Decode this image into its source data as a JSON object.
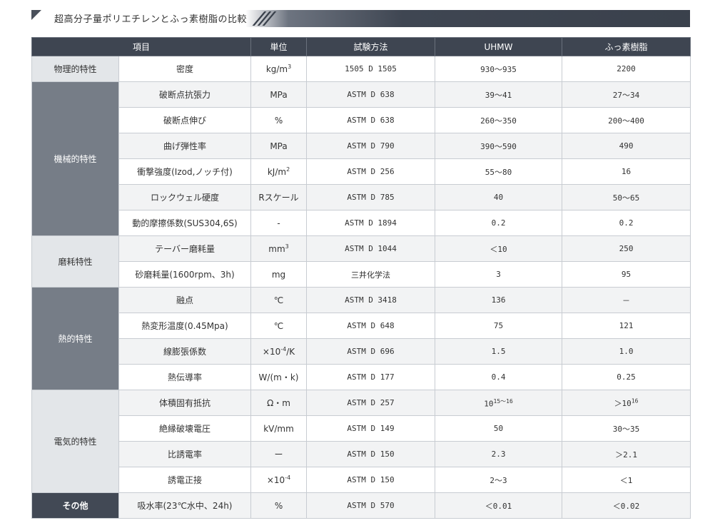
{
  "title": "超高分子量ポリエチレンとふっ素樹脂の比較",
  "headers": [
    "項目",
    "単位",
    "試験方法",
    "UHMW",
    "ふっ素樹脂"
  ],
  "rows": [
    {
      "cat": "物理的特性",
      "span": 1,
      "cls": "c0",
      "item": "密度",
      "unit": "kg/m",
      "unit_sup": "3",
      "method": "1505 D 1505",
      "uhmw": "930～935",
      "uhmw_sup": "",
      "fluoro": "2200",
      "fluoro_sup": ""
    },
    {
      "cat": "機械的特性",
      "span": 6,
      "cls": "c1",
      "item": "破断点抗張力",
      "unit": "MPa",
      "unit_sup": "",
      "method": "ASTM D 638",
      "uhmw": "39～41",
      "uhmw_sup": "",
      "fluoro": "27～34",
      "fluoro_sup": ""
    },
    {
      "item": "破断点伸び",
      "unit": "%",
      "unit_sup": "",
      "method": "ASTM D 638",
      "uhmw": "260～350",
      "uhmw_sup": "",
      "fluoro": "200～400",
      "fluoro_sup": ""
    },
    {
      "item": "曲げ弾性率",
      "unit": "MPa",
      "unit_sup": "",
      "method": "ASTM D 790",
      "uhmw": "390～590",
      "uhmw_sup": "",
      "fluoro": "490",
      "fluoro_sup": ""
    },
    {
      "item": "衝撃強度(Izod,ノッチ付)",
      "unit": "kJ/m",
      "unit_sup": "2",
      "method": "ASTM D 256",
      "uhmw": "55～80",
      "uhmw_sup": "",
      "fluoro": "16",
      "fluoro_sup": ""
    },
    {
      "item": "ロックウェル硬度",
      "unit": "Rスケール",
      "unit_sup": "",
      "method": "ASTM D 785",
      "uhmw": "40",
      "uhmw_sup": "",
      "fluoro": "50～65",
      "fluoro_sup": ""
    },
    {
      "item": "動的摩擦係数(SUS304,6S)",
      "unit": "-",
      "unit_sup": "",
      "method": "ASTM D 1894",
      "uhmw": "0.2",
      "uhmw_sup": "",
      "fluoro": "0.2",
      "fluoro_sup": ""
    },
    {
      "cat": "磨耗特性",
      "span": 2,
      "cls": "c2",
      "item": "テーバー磨耗量",
      "unit": "mm",
      "unit_sup": "3",
      "method": "ASTM D 1044",
      "uhmw": "＜10",
      "uhmw_sup": "",
      "fluoro": "250",
      "fluoro_sup": ""
    },
    {
      "item": "砂磨耗量(1600rpm、3h)",
      "unit": "mg",
      "unit_sup": "",
      "method": "三井化学法",
      "uhmw": "3",
      "uhmw_sup": "",
      "fluoro": "95",
      "fluoro_sup": ""
    },
    {
      "cat": "熱的特性",
      "span": 4,
      "cls": "c3",
      "item": "融点",
      "unit": "℃",
      "unit_sup": "",
      "method": "ASTM D 3418",
      "uhmw": "136",
      "uhmw_sup": "",
      "fluoro": "－",
      "fluoro_sup": ""
    },
    {
      "item": "熱変形温度(0.45Mpa)",
      "unit": "℃",
      "unit_sup": "",
      "method": "ASTM D 648",
      "uhmw": "75",
      "uhmw_sup": "",
      "fluoro": "121",
      "fluoro_sup": ""
    },
    {
      "item": "線膨張係数",
      "unit": "×10",
      "unit_sup": "-4",
      "unit_after": "/K",
      "method": "ASTM D 696",
      "uhmw": "1.5",
      "uhmw_sup": "",
      "fluoro": "1.0",
      "fluoro_sup": ""
    },
    {
      "item": "熱伝導率",
      "unit": "W/(m・k)",
      "unit_sup": "",
      "method": "ASTM D 177",
      "uhmw": "0.4",
      "uhmw_sup": "",
      "fluoro": "0.25",
      "fluoro_sup": ""
    },
    {
      "cat": "電気的特性",
      "span": 4,
      "cls": "c4",
      "item": "体積固有抵抗",
      "unit": "Ω・m",
      "unit_sup": "",
      "method": "ASTM D 257",
      "uhmw": "10",
      "uhmw_sup": "15～16",
      "fluoro": "＞10",
      "fluoro_sup": "16"
    },
    {
      "item": "絶縁破壊電圧",
      "unit": "kV/mm",
      "unit_sup": "",
      "method": "ASTM D 149",
      "uhmw": "50",
      "uhmw_sup": "",
      "fluoro": "30～35",
      "fluoro_sup": ""
    },
    {
      "item": "比誘電率",
      "unit": "ー",
      "unit_sup": "",
      "method": "ASTM D 150",
      "uhmw": "2.3",
      "uhmw_sup": "",
      "fluoro": "＞2.1",
      "fluoro_sup": ""
    },
    {
      "item": "誘電正接",
      "unit": "×10",
      "unit_sup": "-4",
      "method": "ASTM D 150",
      "uhmw": "2～3",
      "uhmw_sup": "",
      "fluoro": "＜1",
      "fluoro_sup": ""
    },
    {
      "cat": "その他",
      "span": 1,
      "cls": "c5",
      "item": "吸水率(23℃水中、24h)",
      "unit": "%",
      "unit_sup": "",
      "method": "ASTM D 570",
      "uhmw": "＜0.01",
      "uhmw_sup": "",
      "fluoro": "＜0.02",
      "fluoro_sup": ""
    }
  ]
}
